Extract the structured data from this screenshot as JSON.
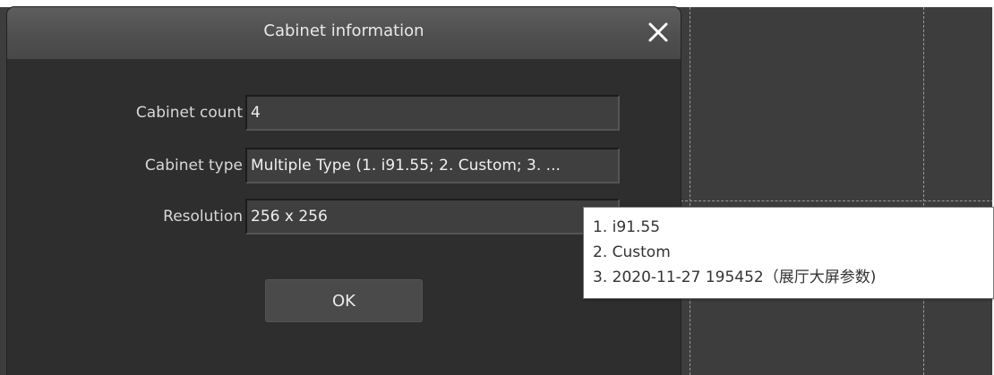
{
  "dialog": {
    "title": "Cabinet information",
    "close_icon": "close-icon",
    "fields": [
      {
        "label": "Cabinet count",
        "value": "4"
      },
      {
        "label": "Cabinet type",
        "value": "Multiple Type (1. i91.55; 2. Custom; 3. ..."
      },
      {
        "label": "Resolution",
        "value": "256 x 256"
      }
    ],
    "ok_label": "OK"
  },
  "tooltip": {
    "lines": [
      "1. i91.55",
      "2. Custom",
      "3. 2020-11-27 195452（展厅大屏参数)"
    ]
  },
  "colors": {
    "dialog_bg": "#2e2e2e",
    "titlebar": "#555555",
    "input_bg": "#3f3f3f",
    "workspace_bg": "#3d3d3d",
    "tooltip_bg": "#ffffff"
  }
}
